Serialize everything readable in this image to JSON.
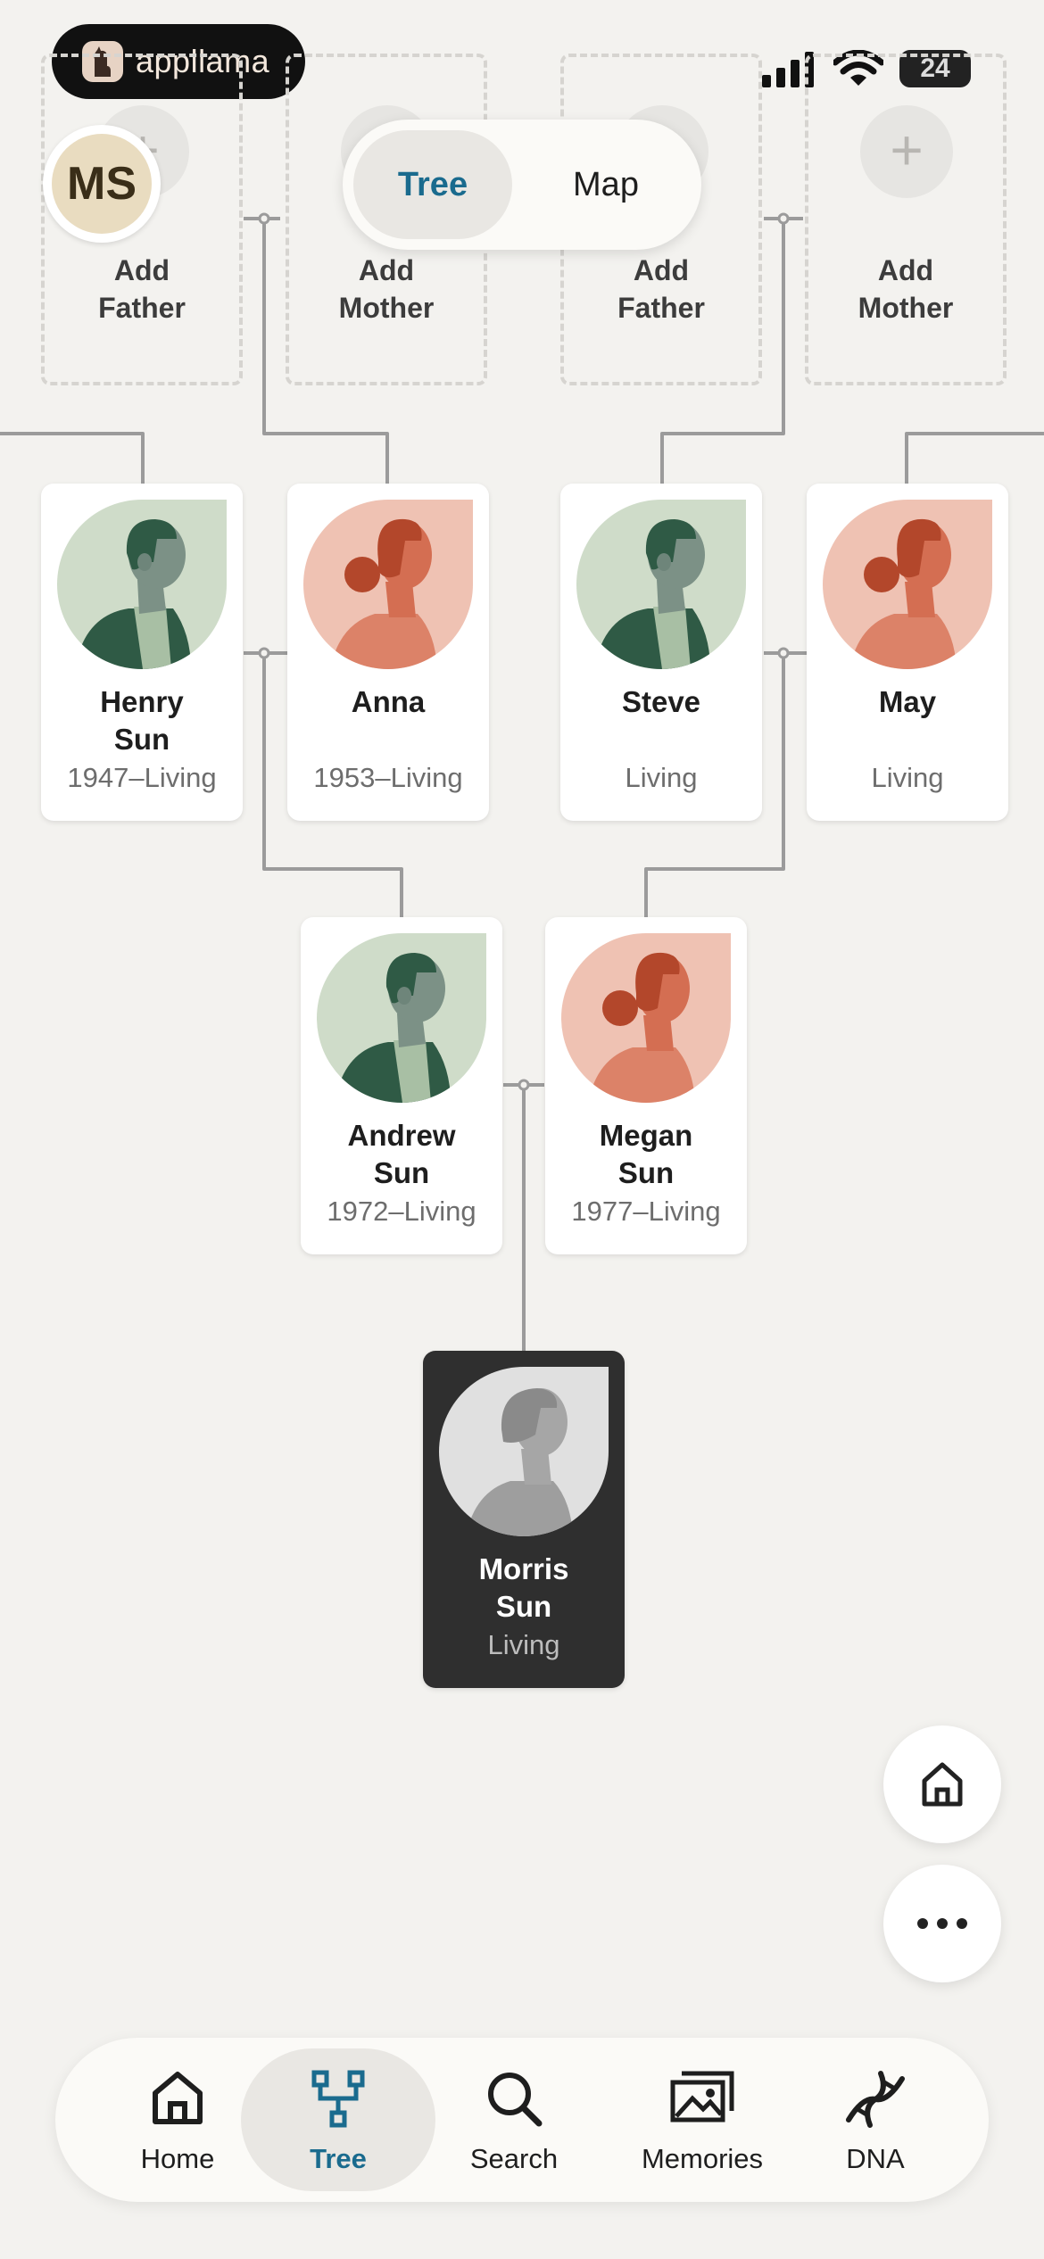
{
  "status_bar": {
    "app_name": "appllama",
    "battery": "24"
  },
  "profile": {
    "initials": "MS"
  },
  "view_toggle": {
    "tree_label": "Tree",
    "map_label": "Map"
  },
  "placeholders": [
    {
      "plus": "+",
      "line1": "Add",
      "line2": "Father"
    },
    {
      "plus": "+",
      "line1": "Add",
      "line2": "Mother"
    },
    {
      "plus": "+",
      "line1": "Add",
      "line2": "Father"
    },
    {
      "plus": "+",
      "line1": "Add",
      "line2": "Mother"
    }
  ],
  "people": [
    {
      "name1": "Henry",
      "name2": "Sun",
      "dates": "1947–Living",
      "gender": "male"
    },
    {
      "name1": "Anna",
      "name2": "",
      "dates": "1953–Living",
      "gender": "female"
    },
    {
      "name1": "Steve",
      "name2": "",
      "dates": "Living",
      "gender": "male"
    },
    {
      "name1": "May",
      "name2": "",
      "dates": "Living",
      "gender": "female"
    },
    {
      "name1": "Andrew",
      "name2": "Sun",
      "dates": "1972–Living",
      "gender": "male"
    },
    {
      "name1": "Megan",
      "name2": "Sun",
      "dates": "1977–Living",
      "gender": "female"
    },
    {
      "name1": "Morris",
      "name2": "Sun",
      "dates": "Living",
      "gender": "unknown"
    }
  ],
  "bottom_nav": [
    {
      "label": "Home",
      "icon": "home-icon",
      "active": false
    },
    {
      "label": "Tree",
      "icon": "tree-icon",
      "active": true
    },
    {
      "label": "Search",
      "icon": "search-icon",
      "active": false
    },
    {
      "label": "Memories",
      "icon": "memories-icon",
      "active": false
    },
    {
      "label": "DNA",
      "icon": "dna-icon",
      "active": false
    }
  ],
  "colors": {
    "accent": "#1a6b8e",
    "male_bg": "#cfdcc9",
    "male_fg": "#2f5a45",
    "female_bg": "#efc2b3",
    "female_fg": "#b3472b",
    "focus_card": "#2f2f2f"
  }
}
